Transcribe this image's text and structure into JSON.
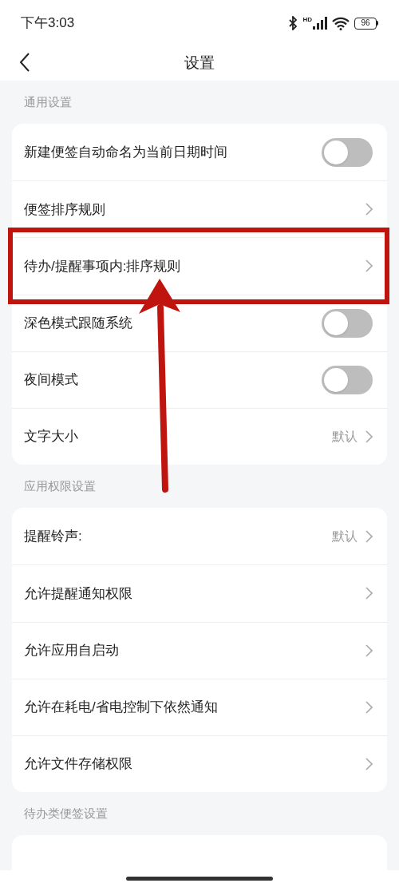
{
  "status_bar": {
    "time": "下午3:03",
    "network": "HD",
    "battery": "96"
  },
  "header": {
    "title": "设置"
  },
  "sections": [
    {
      "title": "通用设置",
      "rows": [
        {
          "kind": "toggle",
          "label": "新建便签自动命名为当前日期时间",
          "on": false,
          "highlighted": false
        },
        {
          "kind": "link",
          "label": "便签排序规则",
          "highlighted": false
        },
        {
          "kind": "link",
          "label": "待办/提醒事项内:排序规则",
          "highlighted": true
        },
        {
          "kind": "toggle",
          "label": "深色模式跟随系统",
          "on": false,
          "highlighted": false
        },
        {
          "kind": "toggle",
          "label": "夜间模式",
          "on": false,
          "highlighted": false
        },
        {
          "kind": "link",
          "label": "文字大小",
          "value": "默认",
          "highlighted": false
        }
      ]
    },
    {
      "title": "应用权限设置",
      "rows": [
        {
          "kind": "link",
          "label": "提醒铃声:",
          "value": "默认",
          "highlighted": false
        },
        {
          "kind": "link",
          "label": "允许提醒通知权限",
          "highlighted": false
        },
        {
          "kind": "link",
          "label": "允许应用自启动",
          "highlighted": false
        },
        {
          "kind": "link",
          "label": "允许在耗电/省电控制下依然通知",
          "highlighted": false
        },
        {
          "kind": "link",
          "label": "允许文件存储权限",
          "highlighted": false
        }
      ]
    },
    {
      "title": "待办类便签设置"
    }
  ]
}
